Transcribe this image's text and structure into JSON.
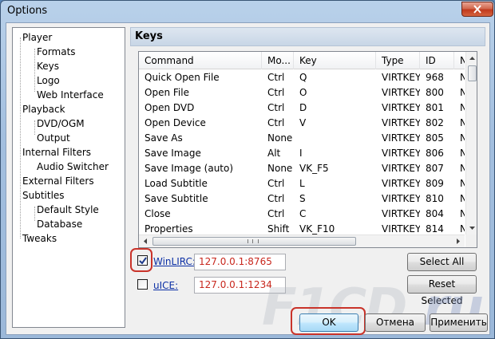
{
  "window": {
    "title": "Options"
  },
  "tree": {
    "items": [
      {
        "label": "Player"
      },
      {
        "label": "Formats"
      },
      {
        "label": "Keys"
      },
      {
        "label": "Logo"
      },
      {
        "label": "Web Interface"
      },
      {
        "label": "Playback"
      },
      {
        "label": "DVD/OGM"
      },
      {
        "label": "Output"
      },
      {
        "label": "Internal Filters"
      },
      {
        "label": "Audio Switcher"
      },
      {
        "label": "External Filters"
      },
      {
        "label": "Subtitles"
      },
      {
        "label": "Default Style"
      },
      {
        "label": "Database"
      },
      {
        "label": "Tweaks"
      }
    ]
  },
  "panel": {
    "title": "Keys"
  },
  "grid": {
    "columns": [
      "Command",
      "Mo...",
      "Key",
      "Type",
      "ID",
      "N"
    ],
    "rows": [
      [
        "Quick Open File",
        "Ctrl",
        "Q",
        "VIRTKEY",
        "968",
        "N"
      ],
      [
        "Open File",
        "Ctrl",
        "O",
        "VIRTKEY",
        "800",
        "N"
      ],
      [
        "Open DVD",
        "Ctrl",
        "D",
        "VIRTKEY",
        "801",
        "N"
      ],
      [
        "Open Device",
        "Ctrl",
        "V",
        "VIRTKEY",
        "802",
        "N"
      ],
      [
        "Save As",
        "None",
        "",
        "VIRTKEY",
        "805",
        "N"
      ],
      [
        "Save Image",
        "Alt",
        "I",
        "VIRTKEY",
        "806",
        "N"
      ],
      [
        "Save Image (auto)",
        "None",
        "VK_F5",
        "VIRTKEY",
        "807",
        "N"
      ],
      [
        "Load Subtitle",
        "Ctrl",
        "L",
        "VIRTKEY",
        "809",
        "N"
      ],
      [
        "Save Subtitle",
        "Ctrl",
        "S",
        "VIRTKEY",
        "810",
        "N"
      ],
      [
        "Close",
        "Ctrl",
        "C",
        "VIRTKEY",
        "804",
        "N"
      ],
      [
        "Properties",
        "Shift",
        "VK_F10",
        "VIRTKEY",
        "814",
        "N"
      ]
    ]
  },
  "remote": {
    "winlirc": {
      "label": "WinLIRC:",
      "address": "127.0.0.1:8765",
      "checked": true
    },
    "uice": {
      "label": "uICE:",
      "address": "127.0.0.1:1234",
      "checked": false
    }
  },
  "buttons": {
    "select_all": "Select All",
    "reset_selected": "Reset Selected",
    "ok": "OK",
    "cancel": "Отмена",
    "apply": "Применить"
  },
  "watermark": {
    "text": "F1CD",
    "suffix": ".ru"
  },
  "colors": {
    "address_text": "#c8271d",
    "highlight": "#c9332a",
    "link": "#0b2fa5"
  }
}
